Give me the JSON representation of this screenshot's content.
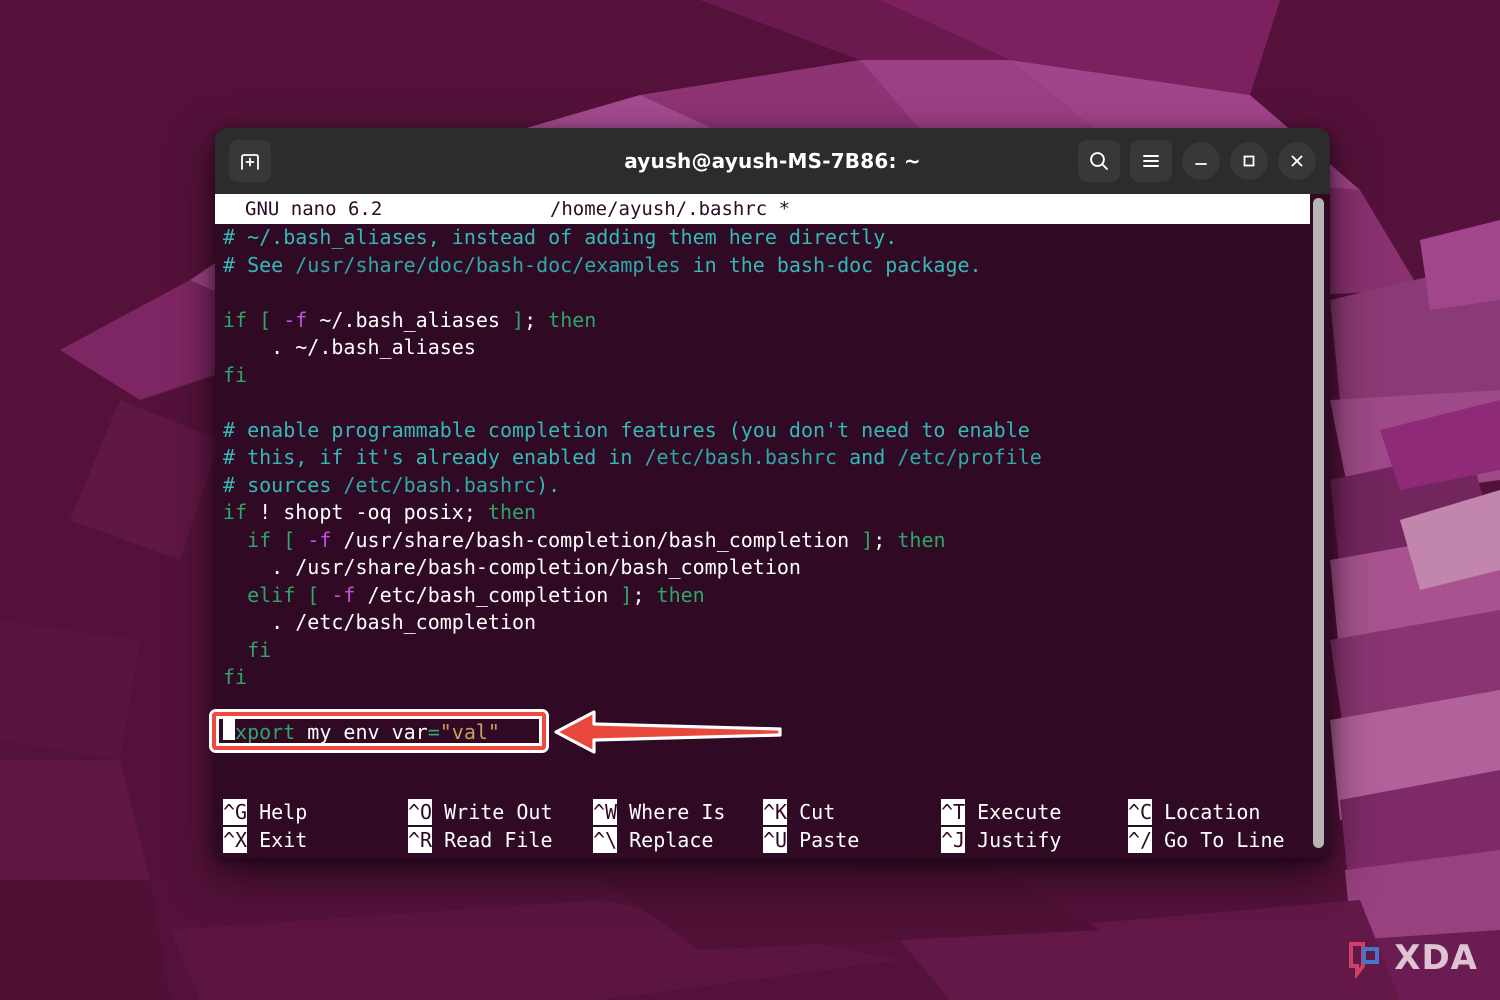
{
  "window": {
    "title": "ayush@ayush-MS-7B86: ~",
    "new_tab_icon": "new-tab-icon",
    "search_icon": "search-icon",
    "menu_icon": "hamburger-menu-icon",
    "minimize_icon": "minimize-icon",
    "maximize_icon": "maximize-icon",
    "close_icon": "close-icon"
  },
  "nano": {
    "version_label": "GNU nano 6.2",
    "file_label": "/home/ayush/.bashrc *",
    "lines": [
      [
        {
          "t": "# ~/.bash_aliases, instead of adding them here directly.",
          "c": "c-comment"
        }
      ],
      [
        {
          "t": "# See ",
          "c": "c-comment"
        },
        {
          "t": "/usr/share/doc/bash-doc/examples",
          "c": "c-path"
        },
        {
          "t": " in the bash-doc package.",
          "c": "c-comment"
        }
      ],
      [],
      [
        {
          "t": "if ",
          "c": "c-kw"
        },
        {
          "t": "[ ",
          "c": "c-kw"
        },
        {
          "t": "-f",
          "c": "c-flag"
        },
        {
          "t": " ~/.bash_aliases ",
          "c": "c-plain"
        },
        {
          "t": "]",
          "c": "c-kw"
        },
        {
          "t": "; ",
          "c": "c-plain"
        },
        {
          "t": "then",
          "c": "c-kw"
        }
      ],
      [
        {
          "t": "    . ~/.bash_aliases",
          "c": "c-plain"
        }
      ],
      [
        {
          "t": "fi",
          "c": "c-kw"
        }
      ],
      [],
      [
        {
          "t": "# enable programmable completion features (you don't need to enable",
          "c": "c-comment"
        }
      ],
      [
        {
          "t": "# this, if it's already enabled in ",
          "c": "c-comment"
        },
        {
          "t": "/etc/bash.bashrc",
          "c": "c-path"
        },
        {
          "t": " and ",
          "c": "c-comment"
        },
        {
          "t": "/etc/profile",
          "c": "c-path"
        }
      ],
      [
        {
          "t": "# sources ",
          "c": "c-comment"
        },
        {
          "t": "/etc/bash.bashrc",
          "c": "c-path"
        },
        {
          "t": ").",
          "c": "c-comment"
        }
      ],
      [
        {
          "t": "if ",
          "c": "c-kw"
        },
        {
          "t": "! shopt -oq posix",
          "c": "c-plain"
        },
        {
          "t": "; ",
          "c": "c-plain"
        },
        {
          "t": "then",
          "c": "c-kw"
        }
      ],
      [
        {
          "t": "  if ",
          "c": "c-kw"
        },
        {
          "t": "[ ",
          "c": "c-kw"
        },
        {
          "t": "-f",
          "c": "c-flag"
        },
        {
          "t": " /usr/share/bash-completion/bash_completion ",
          "c": "c-plain"
        },
        {
          "t": "]",
          "c": "c-kw"
        },
        {
          "t": "; ",
          "c": "c-plain"
        },
        {
          "t": "then",
          "c": "c-kw"
        }
      ],
      [
        {
          "t": "    . /usr/share/bash-completion/bash_completion",
          "c": "c-plain"
        }
      ],
      [
        {
          "t": "  elif ",
          "c": "c-kw"
        },
        {
          "t": "[ ",
          "c": "c-kw"
        },
        {
          "t": "-f",
          "c": "c-flag"
        },
        {
          "t": " /etc/bash_completion ",
          "c": "c-plain"
        },
        {
          "t": "]",
          "c": "c-kw"
        },
        {
          "t": "; ",
          "c": "c-plain"
        },
        {
          "t": "then",
          "c": "c-kw"
        }
      ],
      [
        {
          "t": "    . /etc/bash_completion",
          "c": "c-plain"
        }
      ],
      [
        {
          "t": "  fi",
          "c": "c-kw"
        }
      ],
      [
        {
          "t": "fi",
          "c": "c-kw"
        }
      ],
      [],
      [
        {
          "t": "export",
          "c": "c-kw"
        },
        {
          "t": " my_env_var",
          "c": "c-plain"
        },
        {
          "t": "=",
          "c": "c-kw"
        },
        {
          "t": "\"val\"",
          "c": "c-str"
        }
      ]
    ],
    "shortcuts_row1": [
      {
        "key": "^G",
        "label": "Help"
      },
      {
        "key": "^O",
        "label": "Write Out"
      },
      {
        "key": "^W",
        "label": "Where Is"
      },
      {
        "key": "^K",
        "label": "Cut"
      },
      {
        "key": "^T",
        "label": "Execute"
      },
      {
        "key": "^C",
        "label": "Location"
      }
    ],
    "shortcuts_row2": [
      {
        "key": "^X",
        "label": "Exit"
      },
      {
        "key": "^R",
        "label": "Read File"
      },
      {
        "key": "^\\",
        "label": "Replace"
      },
      {
        "key": "^U",
        "label": "Paste"
      },
      {
        "key": "^J",
        "label": "Justify"
      },
      {
        "key": "^/",
        "label": "Go To Line"
      }
    ]
  },
  "annotation": {
    "highlighted_line": "export my_env_var=\"val\"",
    "arrow_direction": "left",
    "box_color": "#ef4a3d",
    "arrow_color": "#e8473c"
  },
  "watermark": {
    "text": "XDA"
  },
  "colors": {
    "terminal_bg": "#300a24",
    "titlebar_bg": "#2c2c2c",
    "wallpaper_base": "#54123a",
    "comment": "#34b9b9",
    "keyword": "#2fa56a",
    "flag": "#c74de0",
    "string": "#c8a05a"
  }
}
